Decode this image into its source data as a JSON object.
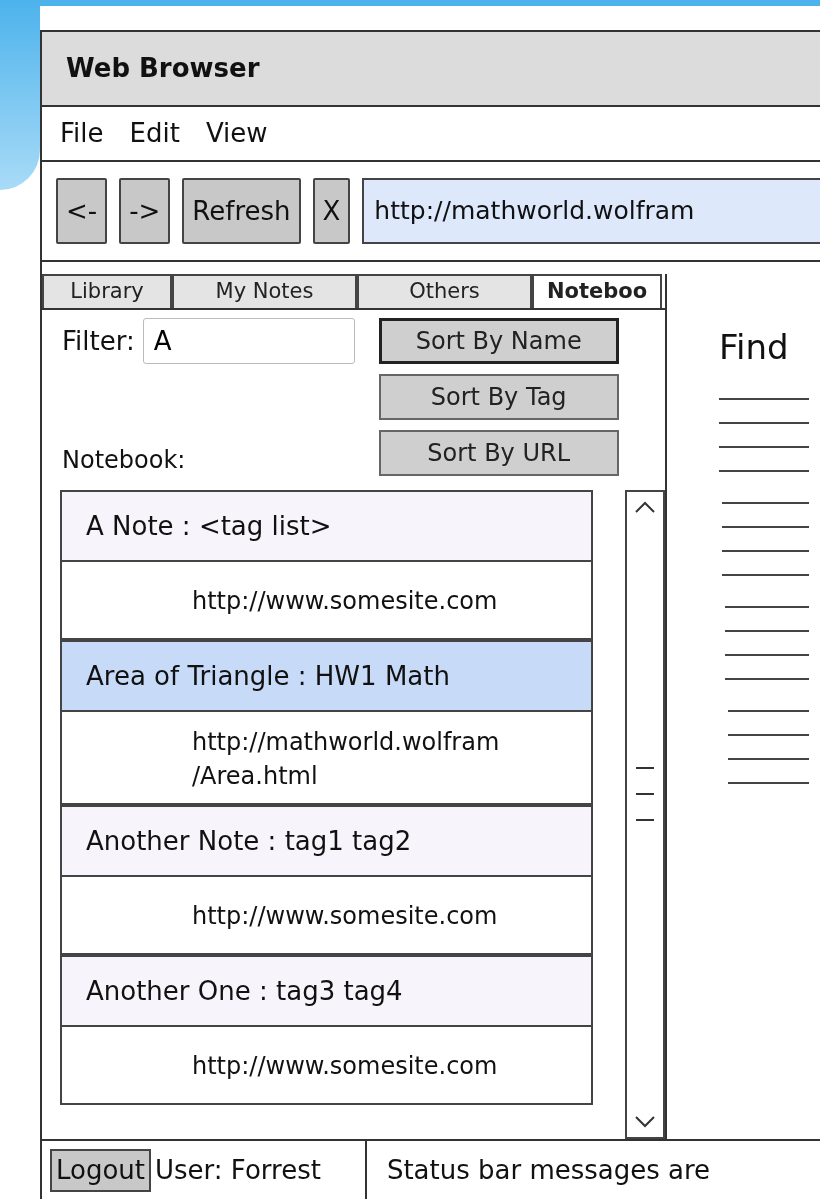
{
  "window": {
    "title": "Web Browser"
  },
  "menu": [
    "File",
    "Edit",
    "View"
  ],
  "toolbar": {
    "buttons": [
      "<-",
      "->",
      "Refresh",
      "X"
    ],
    "address": "http://mathworld.wolfram"
  },
  "tabs": [
    {
      "label": "Library",
      "selected": false
    },
    {
      "label": "My Notes",
      "selected": false
    },
    {
      "label": "Others",
      "selected": false
    },
    {
      "label": "Noteboo",
      "selected": true
    }
  ],
  "filter": {
    "label": "Filter:",
    "value": "A"
  },
  "sort_buttons": [
    {
      "label": "Sort By Name",
      "selected": true
    },
    {
      "label": "Sort By Tag",
      "selected": false
    },
    {
      "label": "Sort By URL",
      "selected": false
    }
  ],
  "notebook_label": "Notebook:",
  "notes": [
    {
      "header": "A Note  :  <tag list>",
      "selected": false,
      "url_lines": [
        "http://www.somesite.com"
      ]
    },
    {
      "header": "Area of Triangle   :  HW1  Math",
      "selected": true,
      "url_lines": [
        "http://mathworld.wolfram",
        "/Area.html"
      ]
    },
    {
      "header": "Another Note  :  tag1  tag2",
      "selected": false,
      "url_lines": [
        "http://www.somesite.com"
      ]
    },
    {
      "header": "Another One  :   tag3  tag4",
      "selected": false,
      "url_lines": [
        "http://www.somesite.com"
      ]
    }
  ],
  "page": {
    "heading": "Find"
  },
  "status_bar": {
    "logout": "Logout",
    "user": "User: Forrest",
    "message": "Status bar messages are"
  }
}
